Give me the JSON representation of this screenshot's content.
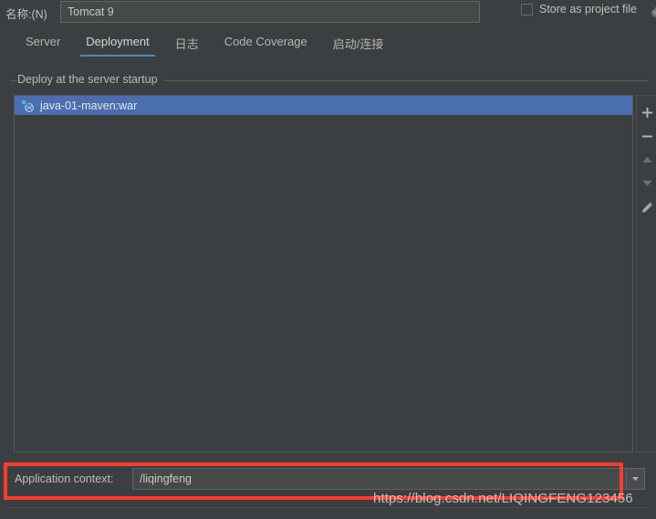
{
  "window": {
    "theme_bg": "#3c3f41",
    "accent": "#4b6eaf",
    "tab_underline": "#4a88c7",
    "annotation_color": "#ff3b30"
  },
  "name_row": {
    "label": "名称:(N)",
    "value": "Tomcat 9",
    "placeholder": "",
    "store_as_project_file_label": "Store as project file",
    "store_as_project_file_checked": false,
    "gear_icon": "gear-icon"
  },
  "tabs": [
    {
      "label": "Server",
      "active": false
    },
    {
      "label": "Deployment",
      "active": true
    },
    {
      "label": "日志",
      "active": false
    },
    {
      "label": "Code Coverage",
      "active": false
    },
    {
      "label": "启动/连接",
      "active": false
    }
  ],
  "deploy_group": {
    "title": "Deploy at the server startup",
    "items": [
      {
        "label": "java-01-maven:war",
        "icon": "artifact-war-icon",
        "selected": true
      }
    ]
  },
  "side_toolbar": [
    {
      "name": "add-button",
      "icon": "plus-icon",
      "enabled": true
    },
    {
      "name": "remove-button",
      "icon": "minus-icon",
      "enabled": true
    },
    {
      "name": "move-up-button",
      "icon": "chevron-up-icon",
      "enabled": false
    },
    {
      "name": "move-down-button",
      "icon": "chevron-down-icon",
      "enabled": false
    },
    {
      "name": "edit-button",
      "icon": "pencil-icon",
      "enabled": true
    }
  ],
  "context_row": {
    "label": "Application context:",
    "value": "/liqingfeng",
    "placeholder": "",
    "dropdown_icon": "triangle-down-icon"
  },
  "watermark": {
    "text": "https://blog.csdn.net/LIQINGFENG123456"
  }
}
